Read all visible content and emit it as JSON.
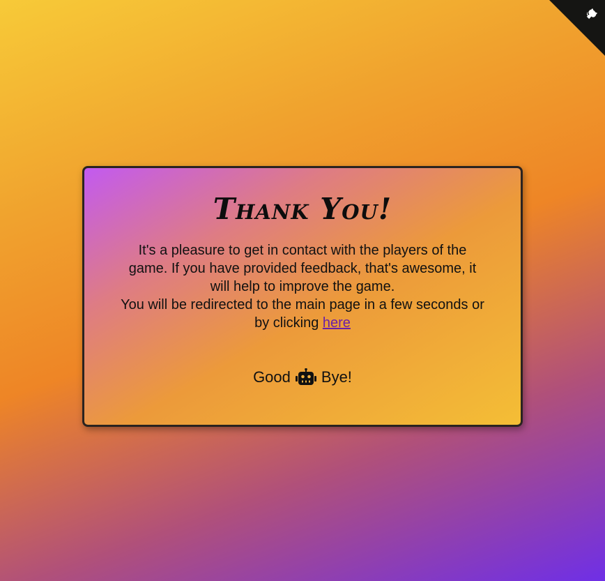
{
  "corner_badge": {
    "icon": "github-octocat-icon",
    "color": "#151513"
  },
  "card": {
    "title": "Thank You!",
    "paragraph_1": "It's a pleasure to get in contact with the players of the game. If you have provided feedback, that's awesome, it will help to improve the game.",
    "paragraph_2_prefix": "You will be redirected to the main page in a few seconds or by clicking ",
    "link_text": "here",
    "farewell_before": "Good",
    "farewell_icon": "robot-icon",
    "farewell_after": "Bye!"
  },
  "colors": {
    "background_top": "#f7ca38",
    "background_mid": "#ee8526",
    "background_bottom": "#6f2fe6",
    "card_start": "#c25af0",
    "card_end": "#f4be36",
    "link": "#6a1fa8"
  }
}
